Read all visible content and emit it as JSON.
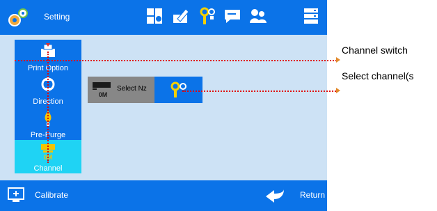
{
  "header": {
    "title": "Setting",
    "toolbar_icons": [
      "app-settings-icon",
      "device-icon",
      "edit-document-icon",
      "nozzle-tool-icon",
      "chat-icon",
      "users-icon",
      "server-icon"
    ]
  },
  "sidebar": {
    "items": [
      {
        "label": "Print Option",
        "icon": "print-icon",
        "active": false
      },
      {
        "label": "Direction",
        "icon": "direction-icon",
        "active": false
      },
      {
        "label": "Pre-Purge",
        "icon": "purge-icon",
        "active": false
      },
      {
        "label": "Channel",
        "icon": "channel-icon",
        "active": true
      }
    ]
  },
  "channel_panel": {
    "select_nozzle_label": "Select Nz",
    "nozzle_badge": "0M"
  },
  "footer": {
    "calibrate_label": "Calibrate",
    "return_label": "Return"
  },
  "annotations": {
    "channel_switch": "Channel switch",
    "select_channel": "Select  channel(s"
  },
  "colors": {
    "bar_blue": "#0b73e8",
    "background": "#cde2f5",
    "active_cyan": "#1fd3f4",
    "annotation_red": "#e00000",
    "arrow_orange": "#e28a2b"
  }
}
